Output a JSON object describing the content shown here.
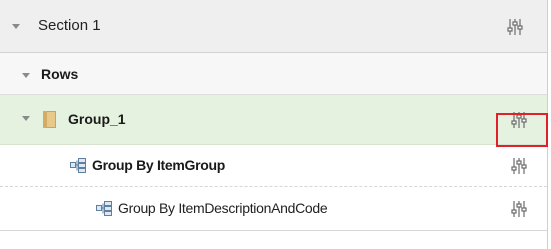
{
  "section": {
    "label": "Section 1",
    "settings_icon": "sliders-icon",
    "collapse_icon": "caret-down-icon"
  },
  "rows_header": {
    "label": "Rows",
    "collapse_icon": "caret-down-icon"
  },
  "group": {
    "label": "Group_1",
    "icon": "folder-icon",
    "settings_icon": "sliders-icon",
    "highlighted": true,
    "highlight_color": "#e0202a",
    "background_color": "#e6f2e0"
  },
  "grouping_items": [
    {
      "label": "Group By ItemGroup",
      "icon": "group-by-icon",
      "settings_icon": "sliders-icon"
    },
    {
      "label": "Group By ItemDescriptionAndCode",
      "icon": "group-by-icon",
      "settings_icon": "sliders-icon"
    }
  ]
}
